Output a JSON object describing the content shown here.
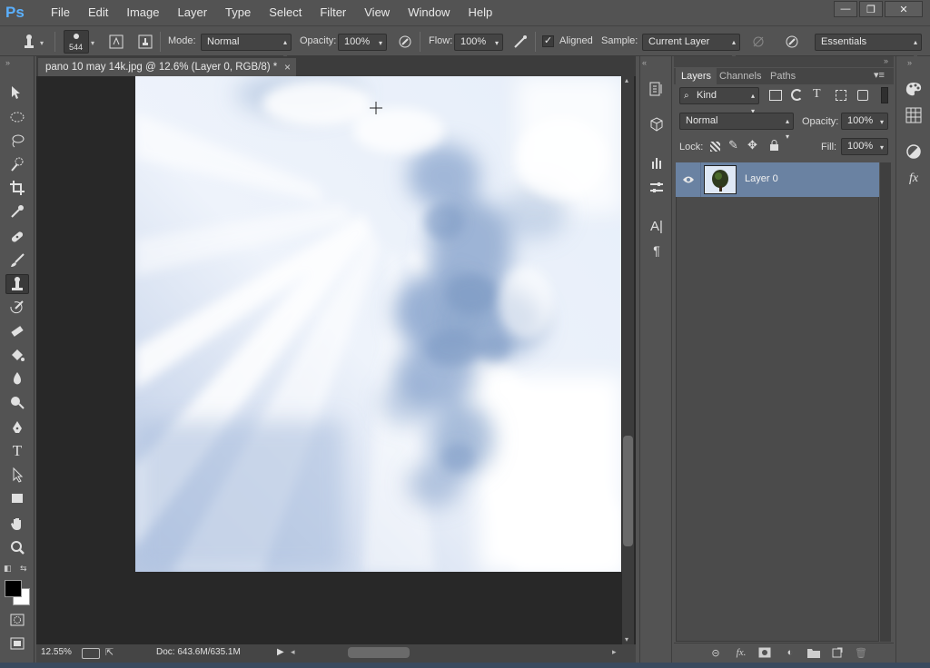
{
  "app": {
    "logo": "Ps"
  },
  "menu": [
    "File",
    "Edit",
    "Image",
    "Layer",
    "Type",
    "Select",
    "Filter",
    "View",
    "Window",
    "Help"
  ],
  "window_buttons": {
    "minimize": "—",
    "restore": "❐",
    "close": "✕"
  },
  "options": {
    "brush_size": "544",
    "mode_label": "Mode:",
    "mode_value": "Normal",
    "opacity_label": "Opacity:",
    "opacity_value": "100%",
    "flow_label": "Flow:",
    "flow_value": "100%",
    "aligned_label": "Aligned",
    "aligned_checked": true,
    "sample_label": "Sample:",
    "sample_value": "Current Layer",
    "workspace_value": "Essentials"
  },
  "document": {
    "tab_title": "pano 10 may 14k.jpg @ 12.6% (Layer 0, RGB/8) *",
    "tab_close": "×"
  },
  "status": {
    "zoom": "12.55%",
    "doc_info": "Doc: 643.6M/635.1M"
  },
  "layers_panel": {
    "tabs": [
      "Layers",
      "Channels",
      "Paths"
    ],
    "active_tab": "Layers",
    "filter_value": "Kind",
    "blend_mode": "Normal",
    "opacity_label": "Opacity:",
    "opacity_value": "100%",
    "lock_label": "Lock:",
    "fill_label": "Fill:",
    "fill_value": "100%",
    "layers": [
      {
        "name": "Layer 0",
        "visible": true
      }
    ]
  },
  "colors": {
    "foreground": "#000000",
    "background": "#ffffff",
    "accent": "#6a82a2"
  }
}
